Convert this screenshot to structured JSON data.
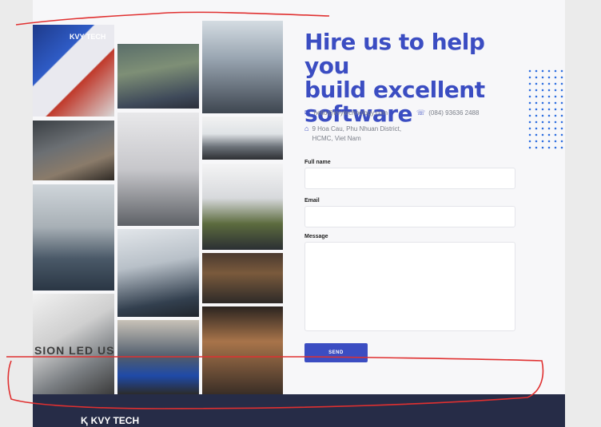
{
  "heading": {
    "line1": "Hire us to help you",
    "line2": "build excellent",
    "line3": "software"
  },
  "contact": {
    "email": "hello@kvytechnology.com",
    "phone": "(084) 93636 2488",
    "address_line1": "9 Hoa Cau, Phu Nhuan District,",
    "address_line2": "HCMC, Viet Nam"
  },
  "form": {
    "fullname_label": "Full name",
    "email_label": "Email",
    "message_label": "Message",
    "send_label": "SEND"
  },
  "photos": {
    "wall_text": "SION LED US H",
    "logo_text": "KVY TECH"
  },
  "footer": {
    "logo_text": "KVY TECH"
  },
  "icons": {
    "email": "envelope-icon",
    "phone": "phone-icon",
    "address": "map-icon"
  },
  "colors": {
    "accent": "#3b4dc2",
    "footer_bg": "#262c47",
    "dots": "#2f6fe0",
    "annotation": "#e03030"
  }
}
